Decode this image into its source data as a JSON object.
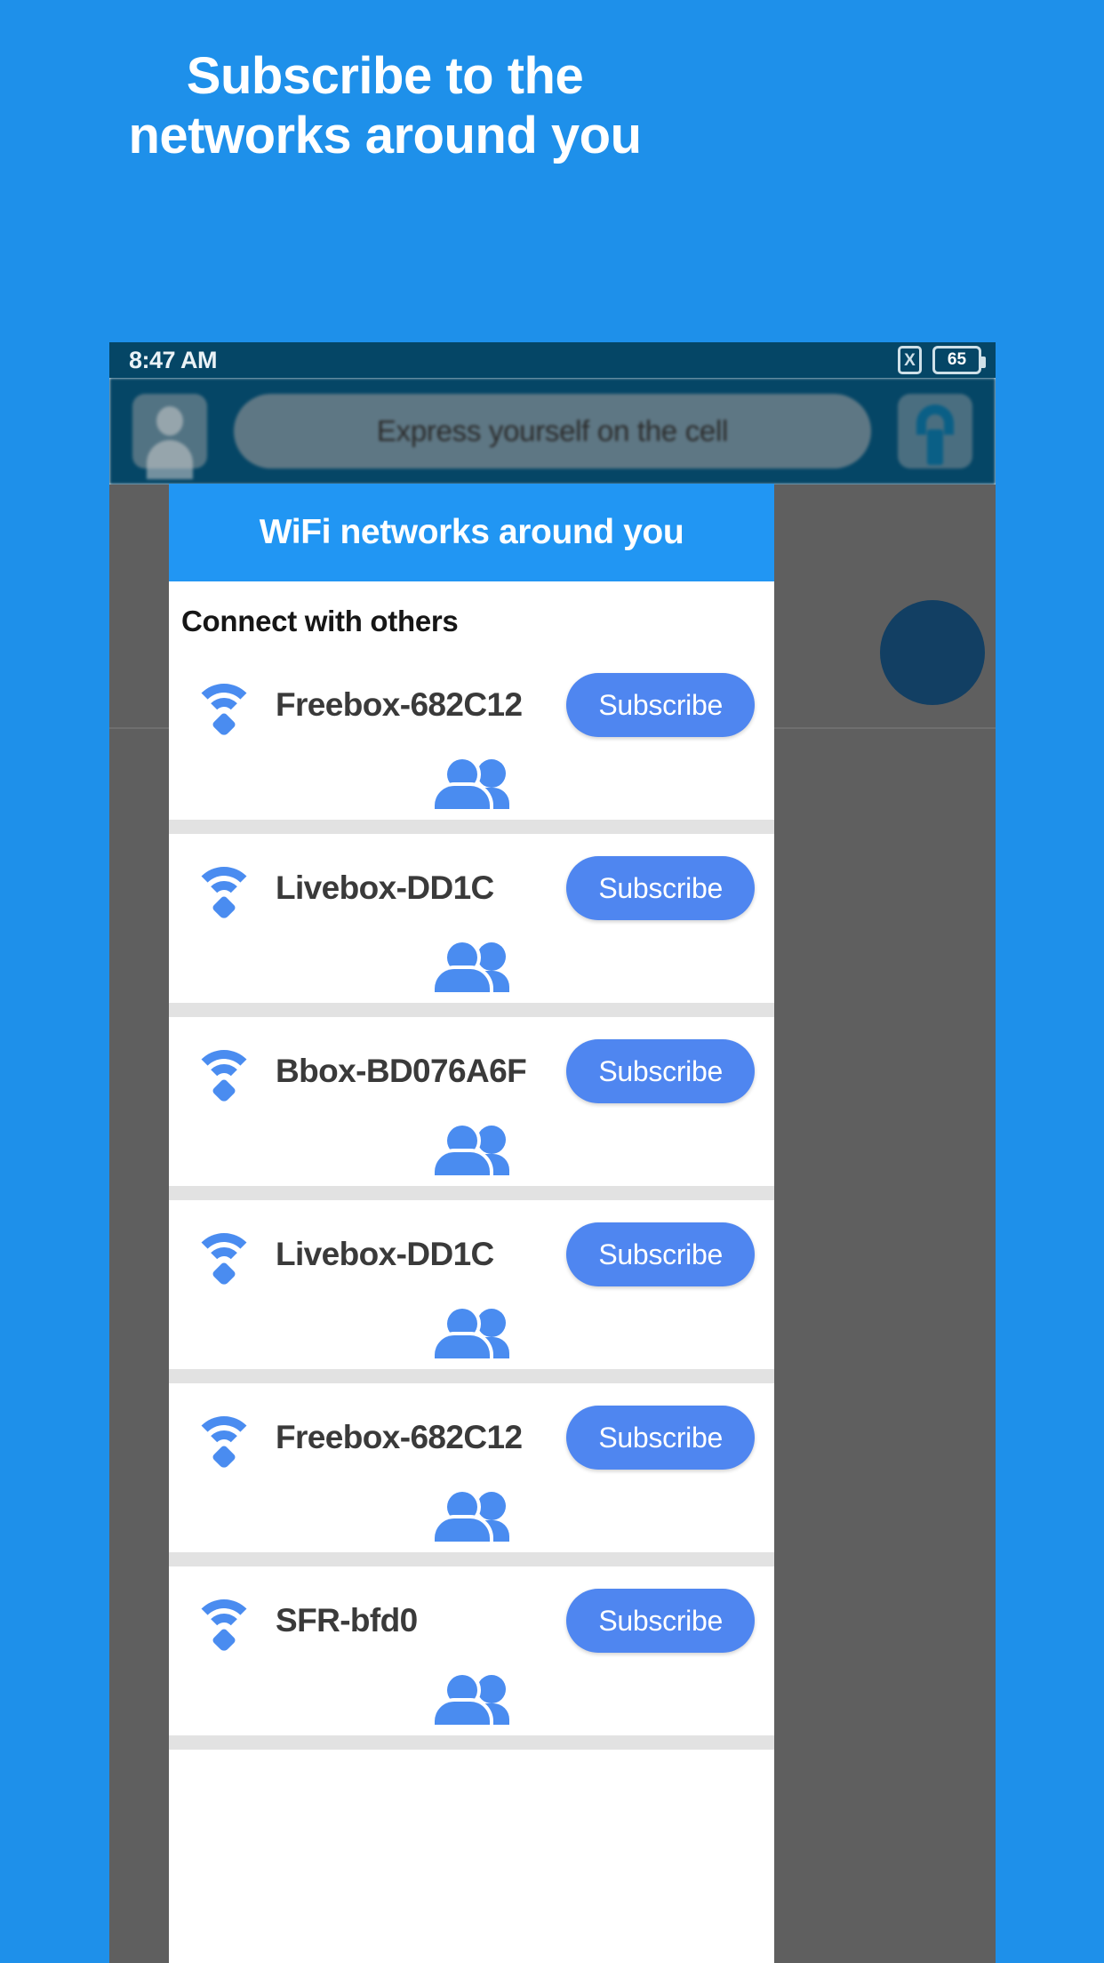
{
  "promo": {
    "headline": "Subscribe to the networks around you",
    "background_color": "#1e90ea"
  },
  "phone": {
    "status_bar": {
      "time": "8:47 AM",
      "sim_icon": "sim-x-icon",
      "sim_label": "X",
      "battery_level": "65",
      "background_color": "#054666"
    },
    "app_bar": {
      "avatar_icon": "avatar-icon",
      "search_text": "Express yourself on the cell",
      "lock_icon": "lock-icon"
    }
  },
  "dialog": {
    "title": "WiFi networks around you",
    "subtitle": "Connect with others",
    "header_color": "#2196f3",
    "accent_color": "#4a8cf0",
    "networks": [
      {
        "name": "Freebox-682C12",
        "action_label": "Subscribe",
        "wifi_icon": "wifi-icon",
        "people_icon": "people-icon"
      },
      {
        "name": "Livebox-DD1C",
        "action_label": "Subscribe",
        "wifi_icon": "wifi-icon",
        "people_icon": "people-icon"
      },
      {
        "name": "Bbox-BD076A6F",
        "action_label": "Subscribe",
        "wifi_icon": "wifi-icon",
        "people_icon": "people-icon"
      },
      {
        "name": "Livebox-DD1C",
        "action_label": "Subscribe",
        "wifi_icon": "wifi-icon",
        "people_icon": "people-icon"
      },
      {
        "name": "Freebox-682C12",
        "action_label": "Subscribe",
        "wifi_icon": "wifi-icon",
        "people_icon": "people-icon"
      },
      {
        "name": "SFR-bfd0",
        "action_label": "Subscribe",
        "wifi_icon": "wifi-icon",
        "people_icon": "people-icon"
      }
    ]
  }
}
